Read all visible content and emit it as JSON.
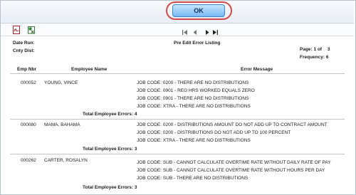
{
  "dialog": {
    "ok_label": "OK"
  },
  "toolbar": {
    "pdf_icon": "pdf-icon",
    "excel_icon": "excel-export-icon",
    "nav_first": "first-page-icon",
    "nav_prev": "previous-page-icon",
    "nav_next": "next-page-icon",
    "nav_last": "last-page-icon"
  },
  "report": {
    "date_run_label": "Date Run:",
    "cnty_dist_label": "Cnty Dist:",
    "title": "Pre Edit Error Listing",
    "page_label": "Page:",
    "page_current": "1",
    "page_of": "of",
    "page_total": "3",
    "frequency_label": "Frequency:",
    "frequency_value": "6",
    "columns": {
      "emp_nbr": "Emp Nbr",
      "employee_name": "Employee Name",
      "error_message": "Error Message"
    },
    "total_errors_label": "Total Employee Errors:",
    "employees": [
      {
        "emp_nbr": "000052",
        "name": "YOUNG, VINCE",
        "errors": [
          "JOB CODE: 0200 - THERE ARE NO DISTRIBUTIONS",
          "JOB CODE: 0901 - REG HRS WORKED EQUALS ZERO",
          "JOB CODE: 0901 - THERE ARE NO DISTRIBUTIONS",
          "JOB CODE: XTRA - THERE ARE NO DISTRIBUTIONS"
        ],
        "total": "4"
      },
      {
        "emp_nbr": "000080",
        "name": "MAMA, BAHAMA",
        "errors": [
          "JOB CODE: 0200 - DISTRIBUTIONS AMOUNT DO NOT ADD UP TO CONTRACT AMOUNT",
          "JOB CODE: 0200 - DISTRIBUTIONS DO NOT ADD UP TO 100 PERCENT",
          "JOB CODE: XTRA - THERE ARE NO DISTRIBUTIONS"
        ],
        "total": "3"
      },
      {
        "emp_nbr": "000262",
        "name": "CARTER, ROSALYN",
        "errors": [
          "JOB CODE: SUB - CANNOT CALCULATE OVERTIME RATE WITHOUT DAILY RATE OF PAY",
          "JOB CODE: SUB - CANNOT CALCULATE OVERTIME RATE WITHOUT HOURS PER DAY",
          "JOB CODE: SUB - THERE ARE NO DISTRIBUTIONS"
        ],
        "total": "3"
      }
    ]
  }
}
